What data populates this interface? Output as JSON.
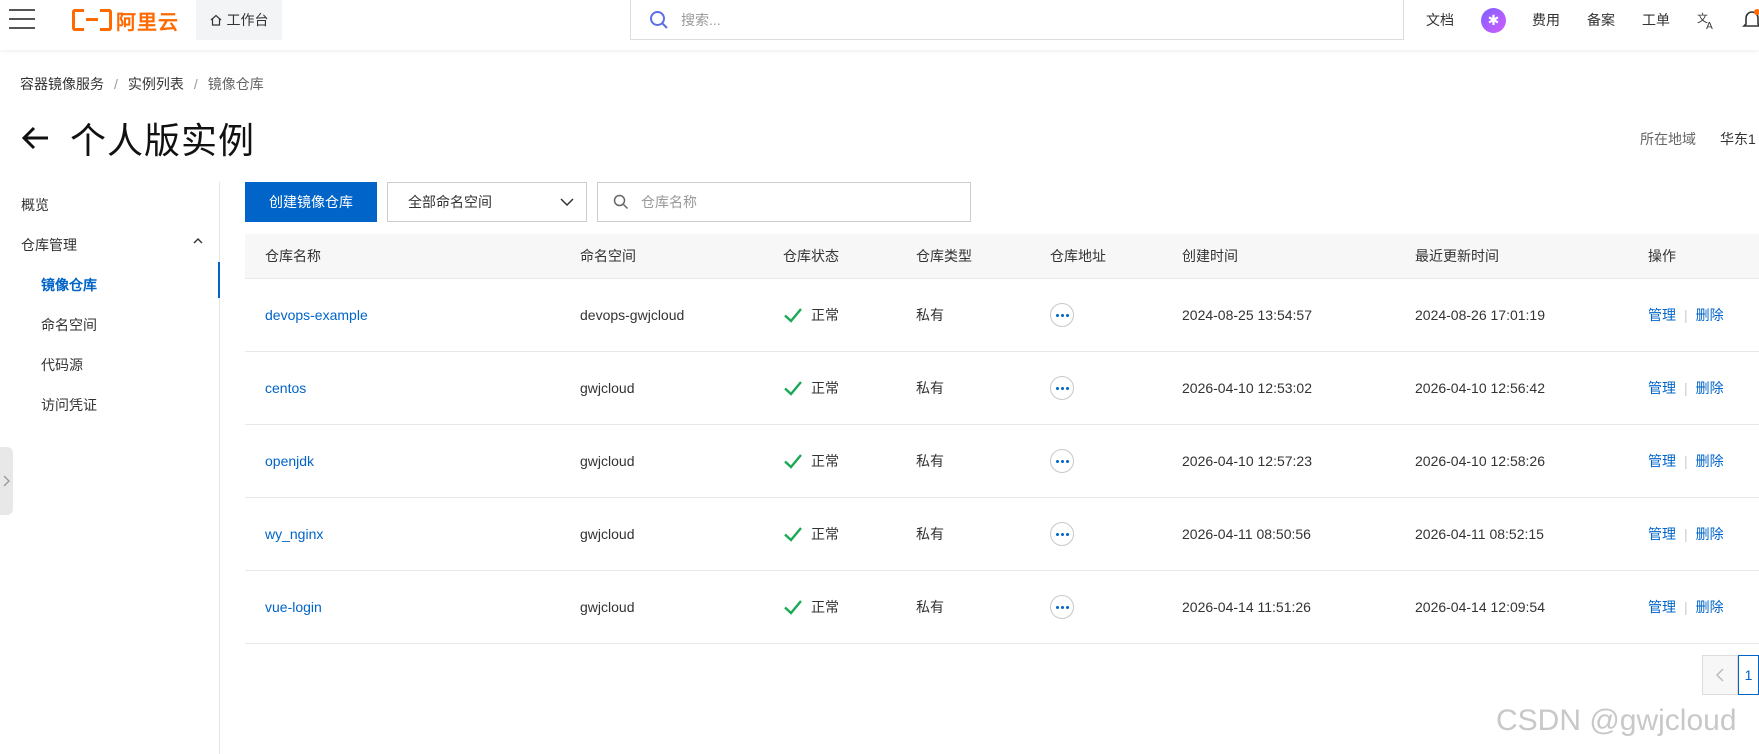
{
  "brand": {
    "name": "阿里云",
    "color": "#ff6a00"
  },
  "topbar": {
    "workbench": "工作台",
    "search_placeholder": "搜索...",
    "nav": [
      "文档",
      "费用",
      "备案",
      "工单"
    ],
    "icons": [
      "menu-icon",
      "home-icon",
      "search-icon",
      "translate-icon",
      "bell-icon"
    ]
  },
  "breadcrumb": [
    "容器镜像服务",
    "实例列表",
    "镜像仓库"
  ],
  "page": {
    "title": "个人版实例",
    "region_label": "所在地域",
    "region_value": "华东1"
  },
  "sidebar": {
    "overview": "概览",
    "group": "仓库管理",
    "items": [
      "镜像仓库",
      "命名空间",
      "代码源",
      "访问凭证"
    ],
    "active": "镜像仓库"
  },
  "toolbar": {
    "create_button": "创建镜像仓库",
    "namespace_select": "全部命名空间",
    "repo_search_placeholder": "仓库名称"
  },
  "table": {
    "columns": [
      "仓库名称",
      "命名空间",
      "仓库状态",
      "仓库类型",
      "仓库地址",
      "创建时间",
      "最近更新时间",
      "操作"
    ],
    "rows": [
      {
        "name": "devops-example",
        "namespace": "devops-gwjcloud",
        "status": "正常",
        "type": "私有",
        "created": "2024-08-25 13:54:57",
        "updated": "2024-08-26 17:01:19",
        "op_manage": "管理",
        "op_delete": "删除"
      },
      {
        "name": "centos",
        "namespace": "gwjcloud",
        "status": "正常",
        "type": "私有",
        "created": "2026-04-10 12:53:02",
        "updated": "2026-04-10 12:56:42",
        "op_manage": "管理",
        "op_delete": "删除"
      },
      {
        "name": "openjdk",
        "namespace": "gwjcloud",
        "status": "正常",
        "type": "私有",
        "created": "2026-04-10 12:57:23",
        "updated": "2026-04-10 12:58:26",
        "op_manage": "管理",
        "op_delete": "删除"
      },
      {
        "name": "wy_nginx",
        "namespace": "gwjcloud",
        "status": "正常",
        "type": "私有",
        "created": "2026-04-11 08:50:56",
        "updated": "2026-04-11 08:52:15",
        "op_manage": "管理",
        "op_delete": "删除"
      },
      {
        "name": "vue-login",
        "namespace": "gwjcloud",
        "status": "正常",
        "type": "私有",
        "created": "2026-04-14 11:51:26",
        "updated": "2026-04-14 12:09:54",
        "op_manage": "管理",
        "op_delete": "删除"
      }
    ]
  },
  "pagination": {
    "current": "1"
  },
  "watermark": "CSDN @gwjcloud",
  "colors": {
    "primary": "#0064c8",
    "success": "#1aaa55"
  }
}
